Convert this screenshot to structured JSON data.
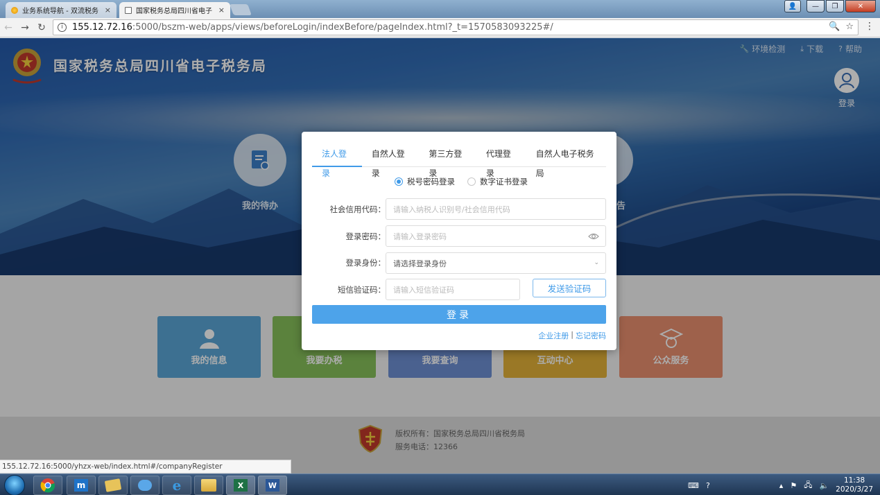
{
  "browser": {
    "tabs": [
      {
        "title": "业务系统导航 - 双流税务",
        "active": false
      },
      {
        "title": "国家税务总局四川省电子",
        "active": true
      }
    ],
    "tab_close": "×",
    "url_host": "155.12.72.16",
    "url_rest": ":5000/bszm-web/apps/views/beforeLogin/indexBefore/pageIndex.html?_t=1570583093225#/",
    "status_url": "155.12.72.16:5000/yhzx-web/index.html#/companyRegister"
  },
  "site": {
    "title": "国家税务总局四川省电子税务局",
    "top_links": [
      {
        "label": "环境检测",
        "icon": "wrench-icon",
        "glyph": "🔧"
      },
      {
        "label": "下载",
        "icon": "download-icon",
        "glyph": "⤓"
      },
      {
        "label": "帮助",
        "icon": "help-icon",
        "glyph": "?"
      }
    ],
    "login_label": "登录",
    "circles": [
      {
        "label": "我的待办"
      },
      {
        "label": "告"
      }
    ],
    "tiles": [
      {
        "label": "我的信息",
        "color": "#5aa6d6"
      },
      {
        "label": "我要办税",
        "color": "#86c05a"
      },
      {
        "label": "我要查询",
        "color": "#6d8fd3"
      },
      {
        "label": "互动中心",
        "color": "#e3b239"
      },
      {
        "label": "公众服务",
        "color": "#e98f6f"
      }
    ],
    "footer": {
      "copyright": "版权所有：国家税务总局四川省税务局",
      "phone": "服务电话：12366"
    }
  },
  "login": {
    "tabs": [
      {
        "label": "法人登录",
        "active": true
      },
      {
        "label": "自然人登录",
        "active": false
      },
      {
        "label": "第三方登录",
        "active": false
      },
      {
        "label": "代理登录",
        "active": false
      },
      {
        "label": "自然人电子税务局",
        "active": false
      }
    ],
    "methods": [
      {
        "label": "税号密码登录",
        "checked": true
      },
      {
        "label": "数字证书登录",
        "checked": false
      }
    ],
    "fields": {
      "credit_code": {
        "label": "社会信用代码：",
        "placeholder": "请输入纳税人识别号/社会信用代码"
      },
      "password": {
        "label": "登录密码：",
        "placeholder": "请输入登录密码"
      },
      "identity": {
        "label": "登录身份：",
        "value": "请选择登录身份"
      },
      "sms": {
        "label": "短信验证码：",
        "placeholder": "请输入短信验证码"
      }
    },
    "send_code_label": "发送验证码",
    "submit_label": "登录",
    "register_link": "企业注册",
    "link_separator": "|",
    "forgot_link": "忘记密码"
  },
  "taskbar": {
    "time": "11:38",
    "date": "2020/3/27"
  }
}
